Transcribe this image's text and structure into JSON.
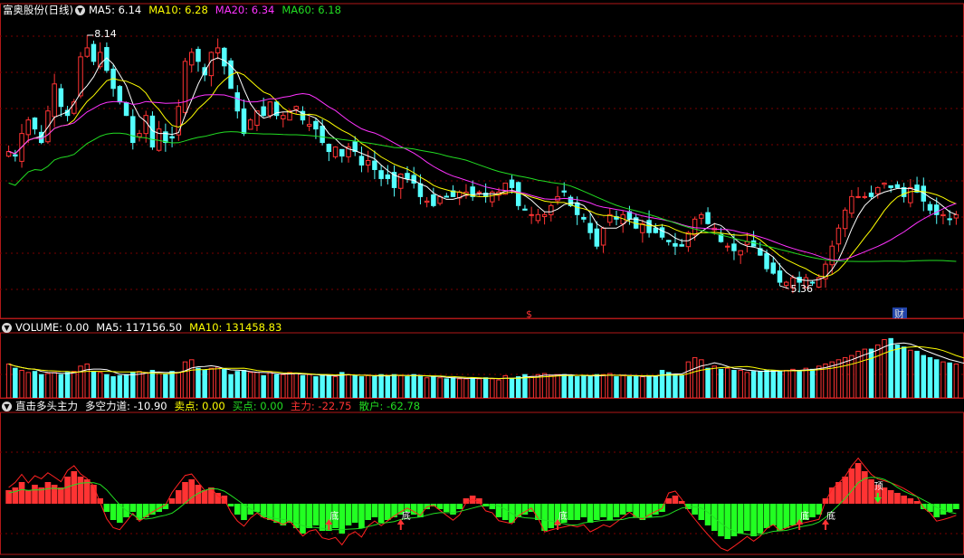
{
  "panel1": {
    "title": "富奥股份(日线)",
    "indicators": [
      {
        "label": "MA5: 6.14",
        "color": "#ffffff"
      },
      {
        "label": "MA10: 6.28",
        "color": "#ffff00"
      },
      {
        "label": "MA20: 6.34",
        "color": "#ff33ff"
      },
      {
        "label": "MA60: 6.18",
        "color": "#22dd22"
      }
    ],
    "high_label": "8.14",
    "low_label": "5.36",
    "event_marks": [
      {
        "text": "$",
        "color": "#ff3333"
      },
      {
        "text": "财",
        "color": "#dddddd",
        "bg": "#2244aa"
      }
    ]
  },
  "panel2": {
    "indicators": [
      {
        "label": "VOLUME: 0.00",
        "color": "#ffffff"
      },
      {
        "label": "MA5: 117156.50",
        "color": "#ffffff"
      },
      {
        "label": "MA10: 131458.83",
        "color": "#ffff00"
      }
    ]
  },
  "panel3": {
    "indicators": [
      {
        "label": "直击多头主力",
        "color": "#ffffff"
      },
      {
        "label": "多空力道: -10.90",
        "color": "#ffffff"
      },
      {
        "label": "卖点: 0.00",
        "color": "#ffff00"
      },
      {
        "label": "买点: 0.00",
        "color": "#22dd22"
      },
      {
        "label": "主力: -22.75",
        "color": "#ff3333"
      },
      {
        "label": "散户: -62.78",
        "color": "#22dd22"
      }
    ],
    "signal_labels": {
      "bottom": "底",
      "top": "顶"
    }
  },
  "colors": {
    "up": "#ff3333",
    "down": "#54ffff",
    "grid": "#7a0000",
    "border": "#b01818"
  },
  "chart_data": [
    {
      "type": "candlestick",
      "title": "富奥股份(日线)",
      "annotations": {
        "max": 8.14,
        "min": 5.36
      },
      "series_names": [
        "MA5",
        "MA10",
        "MA20",
        "MA60"
      ],
      "closes": [
        6.85,
        6.8,
        7.05,
        7.2,
        7.1,
        6.95,
        7.3,
        7.6,
        7.35,
        7.25,
        7.4,
        7.9,
        8.0,
        7.85,
        7.95,
        7.75,
        7.55,
        7.4,
        7.25,
        6.95,
        7.05,
        7.25,
        6.9,
        7.1,
        6.95,
        7.0,
        7.35,
        7.85,
        7.95,
        7.85,
        7.7,
        7.95,
        8.0,
        7.8,
        7.55,
        7.3,
        7.05,
        7.2,
        7.3,
        7.25,
        7.4,
        7.25,
        7.25,
        7.3,
        7.35,
        7.2,
        7.15,
        7.1,
        6.95,
        6.85,
        6.9,
        6.8,
        6.9,
        6.85,
        6.7,
        6.75,
        6.65,
        6.55,
        6.55,
        6.45,
        6.6,
        6.55,
        6.5,
        6.35,
        6.3,
        6.25,
        6.35,
        6.35,
        6.35,
        6.4,
        6.4,
        6.35,
        6.4,
        6.35,
        6.4,
        6.4,
        6.5,
        6.45,
        6.25,
        6.2,
        6.15,
        6.15,
        6.15,
        6.25,
        6.35,
        6.4,
        6.25,
        6.15,
        6.1,
        5.95,
        5.8,
        6.0,
        6.15,
        6.1,
        6.15,
        6.1,
        6.0,
        6.05,
        5.95,
        5.95,
        5.9,
        5.85,
        5.8,
        5.8,
        5.95,
        6.1,
        6.15,
        6.05,
        6.0,
        5.85,
        5.8,
        5.75,
        5.75,
        5.85,
        5.8,
        5.7,
        5.55,
        5.5,
        5.4,
        5.4,
        5.45,
        5.4,
        5.45,
        5.4,
        5.45,
        5.6,
        5.8,
        6.0,
        6.2,
        6.35,
        6.35,
        6.35,
        6.35,
        6.45,
        6.5,
        6.45,
        6.45,
        6.35,
        6.45,
        6.4,
        6.3,
        6.2,
        6.15,
        6.15,
        6.1,
        6.15
      ]
    },
    {
      "type": "bar",
      "title": "VOLUME",
      "series_names": [
        "VOLUME",
        "MA5",
        "MA10"
      ],
      "values": [
        32,
        28,
        26,
        24,
        25,
        22,
        23,
        24,
        22,
        24,
        25,
        30,
        32,
        25,
        24,
        22,
        20,
        21,
        22,
        24,
        25,
        24,
        26,
        23,
        22,
        25,
        24,
        34,
        36,
        28,
        26,
        28,
        29,
        27,
        22,
        25,
        26,
        24,
        24,
        21,
        24,
        22,
        22,
        24,
        23,
        21,
        22,
        20,
        22,
        21,
        20,
        24,
        22,
        21,
        20,
        21,
        20,
        22,
        21,
        22,
        21,
        20,
        22,
        21,
        19,
        20,
        19,
        18,
        19,
        18,
        18,
        19,
        18,
        19,
        18,
        17,
        21,
        18,
        20,
        22,
        20,
        22,
        23,
        21,
        22,
        22,
        21,
        20,
        21,
        20,
        22,
        22,
        23,
        20,
        21,
        20,
        21,
        20,
        21,
        20,
        26,
        24,
        22,
        21,
        34,
        38,
        36,
        28,
        30,
        27,
        28,
        26,
        26,
        24,
        25,
        25,
        26,
        26,
        25,
        26,
        27,
        26,
        28,
        27,
        30,
        32,
        34,
        36,
        38,
        40,
        44,
        46,
        46,
        50,
        55,
        56,
        50,
        48,
        45,
        44,
        40,
        38,
        36,
        34,
        33,
        32,
        30,
        32
      ]
    },
    {
      "type": "bar",
      "title": "直击多头主力",
      "series_names": [
        "多空力道",
        "主力",
        "散户",
        "卖点",
        "买点"
      ],
      "values": [
        5,
        6,
        8,
        5,
        7,
        6,
        8,
        7,
        6,
        10,
        12,
        10,
        9,
        7,
        2,
        -3,
        -6,
        -7,
        -5,
        -3,
        -6,
        -5,
        -4,
        -3,
        -2,
        2,
        5,
        8,
        9,
        7,
        5,
        6,
        4,
        3,
        -1,
        -4,
        -6,
        -4,
        -3,
        -5,
        -6,
        -7,
        -8,
        -7,
        -9,
        -11,
        -9,
        -8,
        -10,
        -10,
        -9,
        -11,
        -8,
        -7,
        -9,
        -6,
        -5,
        -7,
        -6,
        -5,
        -4,
        -3,
        -4,
        -5,
        -2,
        -1,
        -2,
        -3,
        -4,
        -2,
        2,
        3,
        2,
        -1,
        -2,
        -5,
        -6,
        -7,
        -5,
        -4,
        -3,
        -6,
        -10,
        -9,
        -8,
        -7,
        -6,
        -6,
        -5,
        -7,
        -6,
        -5,
        -6,
        -5,
        -4,
        -3,
        -5,
        -6,
        -5,
        -4,
        -3,
        2,
        3,
        1,
        -2,
        -4,
        -6,
        -8,
        -10,
        -12,
        -13,
        -12,
        -11,
        -10,
        -12,
        -11,
        -9,
        -8,
        -10,
        -9,
        -8,
        -7,
        -6,
        -5,
        -4,
        2,
        6,
        8,
        10,
        13,
        15,
        12,
        9,
        7,
        6,
        5,
        4,
        3,
        2,
        1,
        -2,
        -3,
        -5,
        -4,
        -3,
        -2
      ]
    }
  ]
}
